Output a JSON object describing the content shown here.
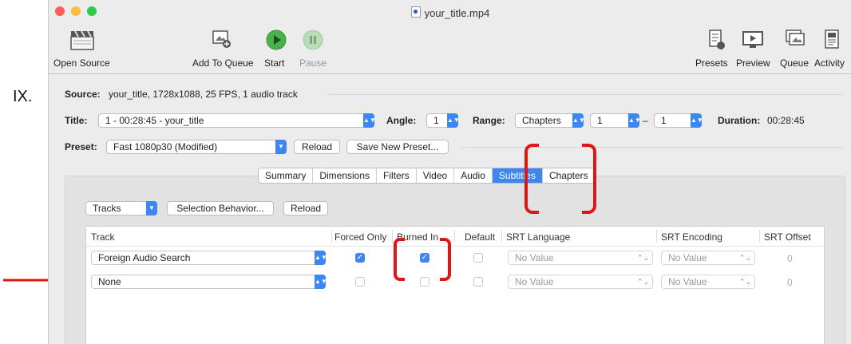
{
  "annotation_label": "IX.",
  "window": {
    "title": "your_title.mp4",
    "traffic_lights": {
      "close": "#fc605c",
      "minimize": "#fdbc40",
      "zoom": "#34c84a"
    }
  },
  "toolbar": {
    "open_source": "Open Source",
    "add_to_queue": "Add To Queue",
    "start": "Start",
    "pause": "Pause",
    "presets": "Presets",
    "preview": "Preview",
    "queue": "Queue",
    "activity": "Activity"
  },
  "source": {
    "label": "Source:",
    "value": "your_title, 1728x1088, 25 FPS, 1 audio track"
  },
  "title_row": {
    "title_label": "Title:",
    "title_value": "1 - 00:28:45 - your_title",
    "angle_label": "Angle:",
    "angle_value": "1",
    "range_label": "Range:",
    "range_type": "Chapters",
    "range_start": "1",
    "range_dash": "–",
    "range_end": "1",
    "duration_label": "Duration:",
    "duration_value": "00:28:45"
  },
  "preset_row": {
    "label": "Preset:",
    "value": "Fast 1080p30 (Modified)",
    "reload": "Reload",
    "save_new": "Save New Preset..."
  },
  "tabs": [
    "Summary",
    "Dimensions",
    "Filters",
    "Video",
    "Audio",
    "Subtitles",
    "Chapters"
  ],
  "active_tab": "Subtitles",
  "subtitles": {
    "tracks_popup": "Tracks",
    "selection_behavior": "Selection Behavior...",
    "reload": "Reload",
    "columns": {
      "track": "Track",
      "forced_only": "Forced Only",
      "burned_in": "Burned In",
      "default": "Default",
      "srt_language": "SRT Language",
      "srt_encoding": "SRT Encoding",
      "srt_offset": "SRT Offset"
    },
    "rows": [
      {
        "track": "Foreign Audio Search",
        "forced_only": true,
        "burned_in": true,
        "default": false,
        "srt_language": "No Value",
        "srt_encoding": "No Value",
        "srt_offset": "0"
      },
      {
        "track": "None",
        "forced_only": false,
        "burned_in": false,
        "default": false,
        "srt_language": "No Value",
        "srt_encoding": "No Value",
        "srt_offset": "0"
      }
    ]
  },
  "accent_color": "#3d87f5",
  "annotation_color": "#e01616"
}
